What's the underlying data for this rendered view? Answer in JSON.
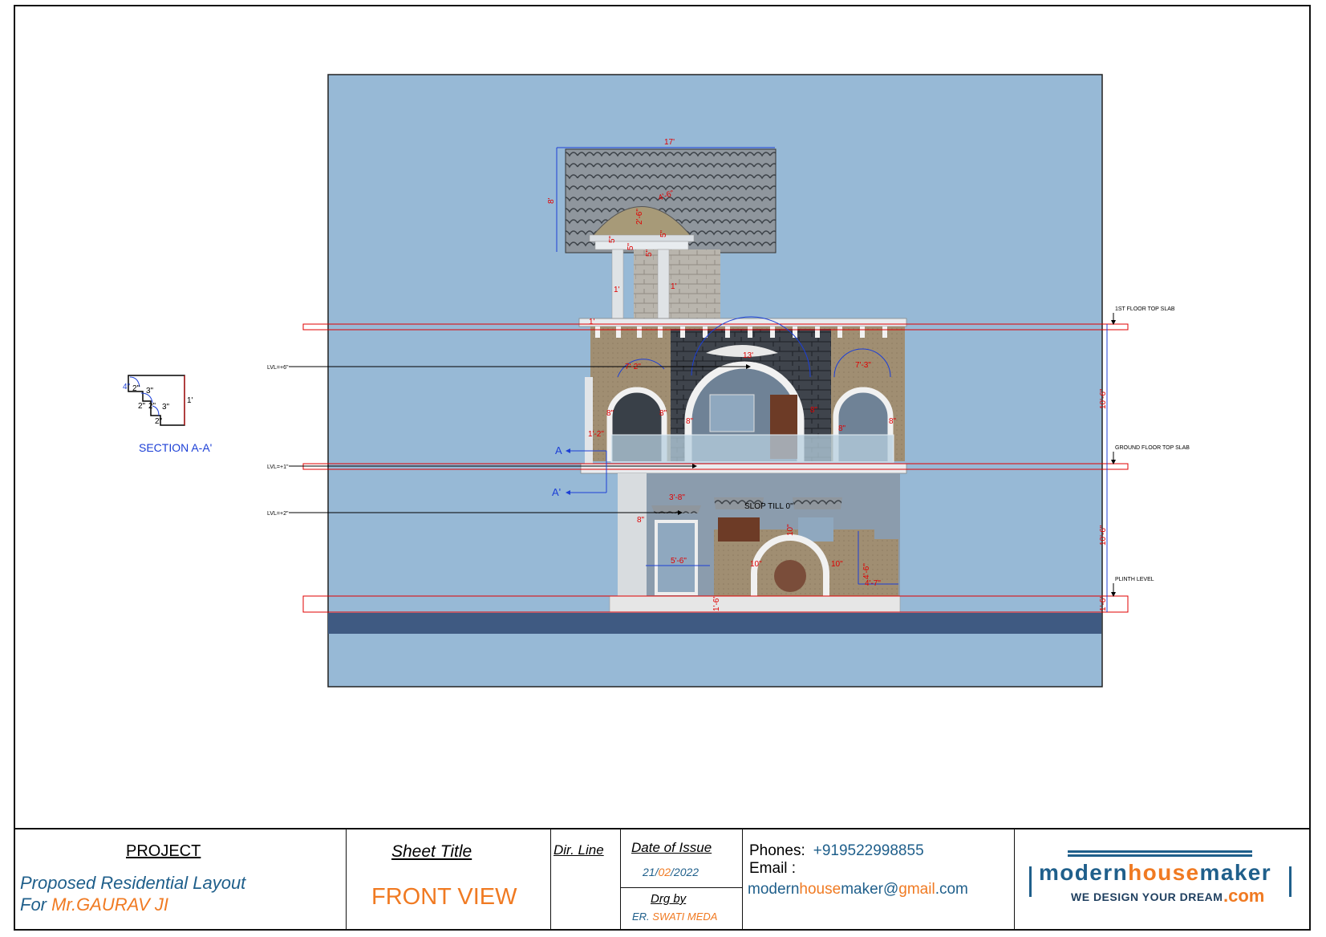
{
  "titleblock": {
    "project_heading": "PROJECT",
    "project_line1": "Proposed Residential Layout",
    "project_for": "For ",
    "project_client": "Mr.GAURAV JI",
    "sheet_title_heading": "Sheet Title",
    "sheet_title_value": "FRONT VIEW",
    "dir_line": "Dir. Line",
    "date_heading": "Date of Issue",
    "date_day": "21/",
    "date_month": "02",
    "date_year": "/2022",
    "drg_heading": "Drg by",
    "drg_prefix": "ER. ",
    "drg_name": "SWATI MEDA",
    "phones_label": "Phones:",
    "phones_value": "+919522998855",
    "email_label": "Email :",
    "email_part1": "modern",
    "email_part2": "house",
    "email_part3": "maker@",
    "email_part4": "gmail",
    "email_part5": ".com",
    "logo_modern": "modern",
    "logo_house": "house",
    "logo_maker": "maker",
    "logo_tagline": "WE DESIGN YOUR DREAM",
    "logo_com": ".com"
  },
  "drawing": {
    "section_label": "SECTION A-A'",
    "levels": {
      "first_floor_top_slab": "1ST FLOOR TOP SLAB",
      "ground_floor_top_slab": "GROUND FLOOR TOP SLAB",
      "plinth_level": "PLINTH LEVEL",
      "lvl_6": "LVL=+6\"",
      "lvl_1": "LVL=+1\"",
      "lvl_2": "LVL=+2\""
    },
    "section_markers": {
      "a": "A",
      "a_prime": "A'"
    },
    "slope_note": "SLOP TILL 0\"",
    "dimensions": {
      "roof_width": "17'",
      "roof_height": "8'",
      "dome_arc": "4'-6\"",
      "dome_height": "2'-6\"",
      "d5a": "5\"",
      "d5b": "5\"",
      "d5c": "5\"",
      "d5d": "5\"",
      "d1a": "1'",
      "d1b": "1'",
      "d1c": "1'",
      "arch_center": "13'",
      "arch_left": "7'-2\"",
      "arch_right": "7'-3\"",
      "d8a": "8\"",
      "d8b": "8\"",
      "d8c": "8\"",
      "d8d": "8\"",
      "d8e": "8\"",
      "d8f": "8\"",
      "d8g": "8\"",
      "d1_2": "1'-2\"",
      "floor_height_1": "10'-6\"",
      "floor_height_2": "10'-6\"",
      "plinth_height": "1'-6\"",
      "plinth_right": "1'-6\"",
      "window_width": "5'-6\"",
      "window_top": "3'-8\"",
      "d10a": "10\"",
      "d10b": "10\"",
      "d10c": "10\"",
      "gate_height": "4'-6\"",
      "gate_base": "4'-7\"",
      "sec_4": "4\"",
      "sec_3a": "3\"",
      "sec_3b": "3\"",
      "sec_2a": "2\"",
      "sec_2b": "2\"",
      "sec_2c": "2\"",
      "sec_2d": "2\"",
      "sec_1": "1'"
    }
  },
  "colors": {
    "sky": "#97b9d6",
    "ground": "#3f5a82",
    "dimension": "#e00000",
    "dim_line": "#1c3fd6",
    "accent_orange": "#f07a22",
    "accent_blue": "#1f5f8b"
  }
}
